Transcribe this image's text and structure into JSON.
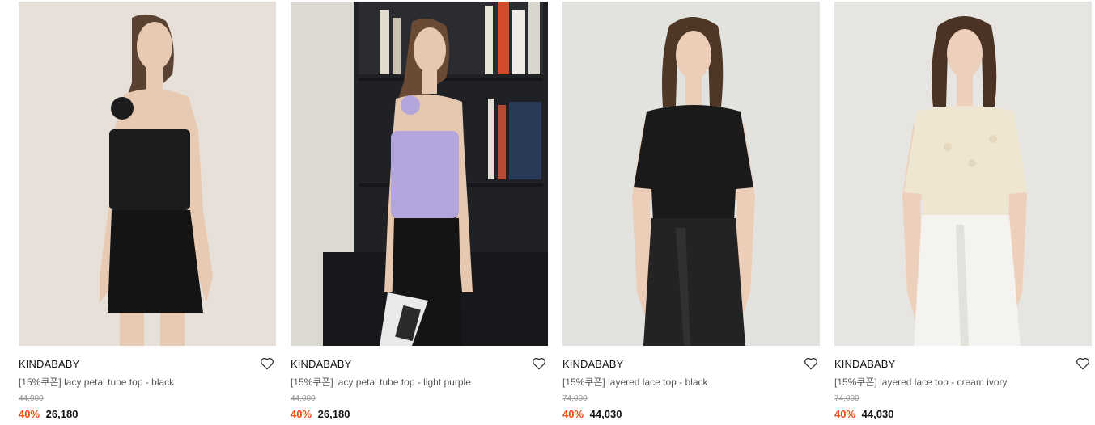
{
  "colors": {
    "discount": "#f04a12",
    "text": "#111111",
    "muted": "#555555",
    "strike": "#999999"
  },
  "products": [
    {
      "brand": "KINDABABY",
      "name": "[15%쿠폰] lacy petal tube top - black",
      "original_price": "44,000",
      "discount": "40%",
      "sale_price": "26,180",
      "icon": "heart-outline-icon",
      "photo": "model-black-tube-top"
    },
    {
      "brand": "KINDABABY",
      "name": "[15%쿠폰] lacy petal tube top - light purple",
      "original_price": "44,000",
      "discount": "40%",
      "sale_price": "26,180",
      "icon": "heart-outline-icon",
      "photo": "model-purple-tube-top"
    },
    {
      "brand": "KINDABABY",
      "name": "[15%쿠폰] layered lace top - black",
      "original_price": "74,000",
      "discount": "40%",
      "sale_price": "44,030",
      "icon": "heart-outline-icon",
      "photo": "model-black-lace-top"
    },
    {
      "brand": "KINDABABY",
      "name": "[15%쿠폰] layered lace top - cream ivory",
      "original_price": "74,000",
      "discount": "40%",
      "sale_price": "44,030",
      "icon": "heart-outline-icon",
      "photo": "model-cream-lace-top"
    }
  ]
}
